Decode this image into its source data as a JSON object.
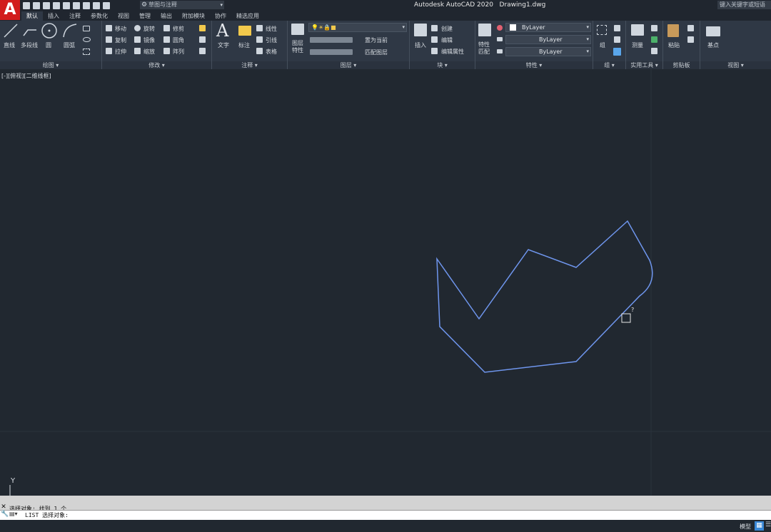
{
  "titlebar": {
    "logo": "A",
    "workspace": "草图与注释",
    "title": "Autodesk AutoCAD 2020   Drawing1.dwg",
    "search_placeholder": "键入关键字或短语"
  },
  "ribbon_tabs": [
    "默认",
    "插入",
    "注释",
    "参数化",
    "视图",
    "管理",
    "输出",
    "附加模块",
    "协作",
    "精选应用"
  ],
  "ribbon": {
    "draw": {
      "title": "绘图 ▾",
      "tools": [
        "直线",
        "多段线",
        "圆",
        "圆弧"
      ]
    },
    "modify": {
      "title": "修改 ▾",
      "tools": [
        "移动",
        "旋转",
        "修剪",
        "复制",
        "镜像",
        "圆角",
        "拉伸",
        "缩放",
        "阵列"
      ]
    },
    "annotation": {
      "title": "注释 ▾",
      "tools": [
        "文字",
        "标注",
        "线性",
        "引线",
        "表格"
      ]
    },
    "layers": {
      "title": "图层 ▾",
      "layer_props": "图层\n特性",
      "current_layer": "0",
      "tools": [
        "置为当前",
        "匹配图层"
      ]
    },
    "block": {
      "title": "块 ▾",
      "insert": "插入",
      "tools": [
        "创建",
        "编辑",
        "编辑属性"
      ]
    },
    "properties": {
      "title": "特性 ▾",
      "match": "特性\n匹配",
      "color": "ByLayer",
      "linetype": "ByLayer",
      "lineweight": "ByLayer"
    },
    "groups": {
      "title": "组 ▾",
      "group": "组"
    },
    "utilities": {
      "title": "实用工具 ▾",
      "measure": "测量"
    },
    "clipboard": {
      "title": "剪贴板",
      "paste": "粘贴"
    },
    "view": {
      "title": "视图 ▾",
      "base": "基点"
    }
  },
  "viewport": {
    "label": "[-][俯视][二维线框]"
  },
  "drawing": {
    "stroke_color": "#6f96ee",
    "pickbox_label": "?",
    "ucs_y_label": "Y"
  },
  "command": {
    "close": "✕",
    "history": "选择对象: 找到 1 个",
    "wrench": "🔧",
    "input": "LIST 选择对象:"
  },
  "statusbar": {
    "model": "模型",
    "grid": "▦",
    "menu": "☰"
  }
}
